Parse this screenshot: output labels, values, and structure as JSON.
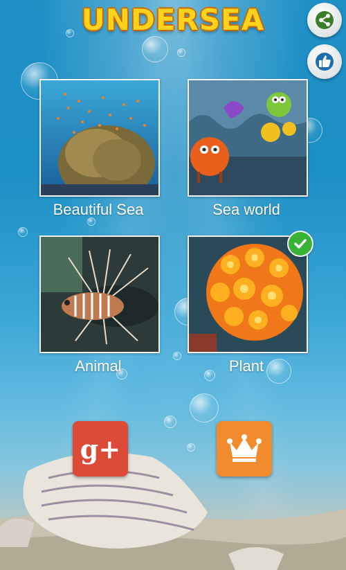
{
  "app": {
    "title": "UNDERSEA"
  },
  "header": {
    "share_icon": "share-icon",
    "like_icon": "thumbs-up-icon"
  },
  "categories": [
    {
      "label": "Beautiful Sea",
      "image": "coral-reef-with-fish",
      "selected": false
    },
    {
      "label": "Sea world",
      "image": "cartoon-sea-creatures",
      "selected": false
    },
    {
      "label": "Animal",
      "image": "lionfish",
      "selected": false
    },
    {
      "label": "Plant",
      "image": "orange-sea-anemone",
      "selected": true
    }
  ],
  "bottom_buttons": [
    {
      "name": "google-plus",
      "label": "g+",
      "color": "#dc4a38"
    },
    {
      "name": "crown",
      "icon": "crown-icon",
      "color": "#f28a2e"
    }
  ],
  "colors": {
    "title": "#ffd21f",
    "title_outline": "#c96a00",
    "check": "#38b335"
  }
}
